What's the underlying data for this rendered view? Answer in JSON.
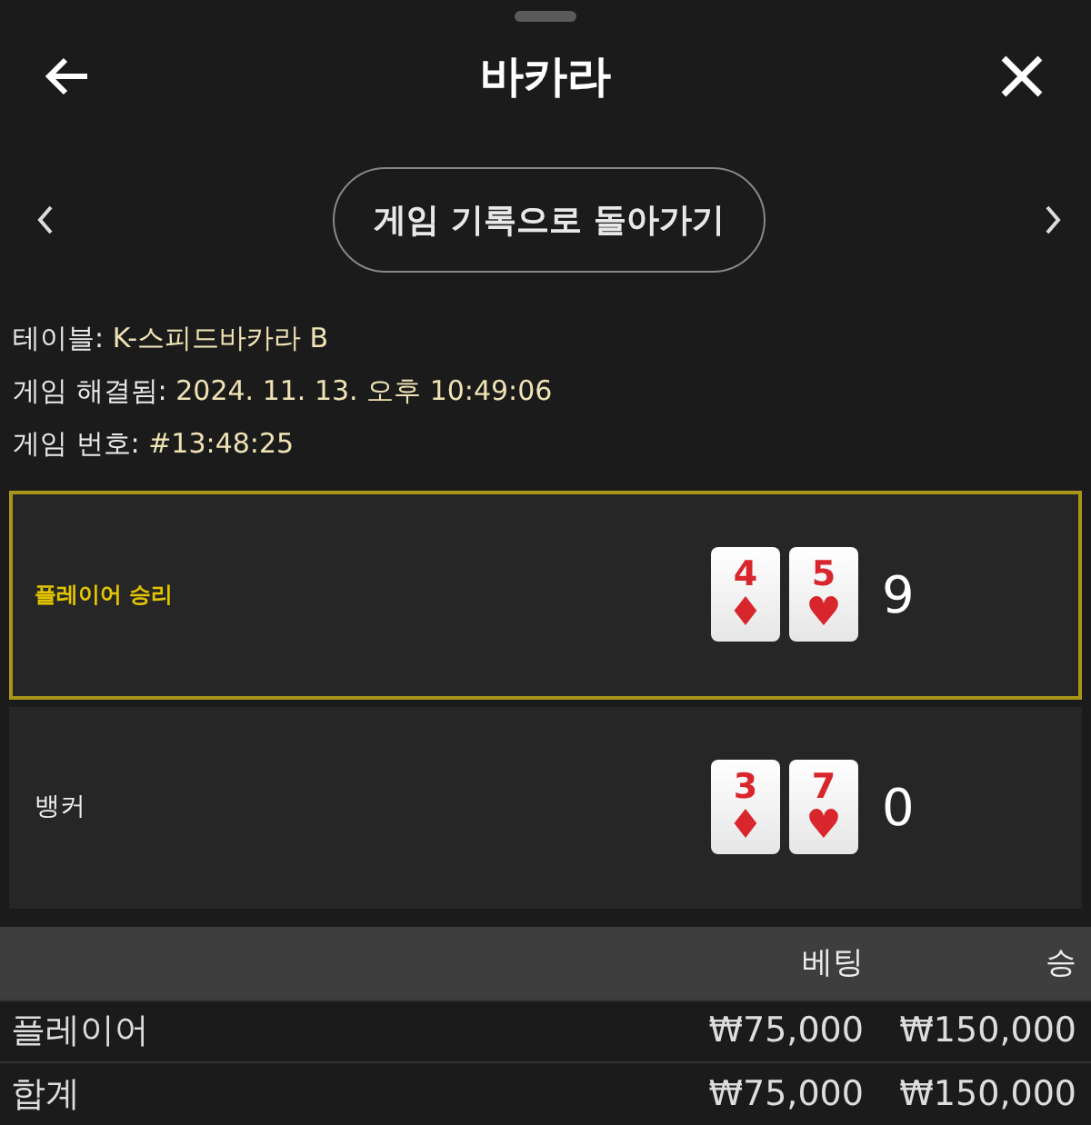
{
  "header": {
    "title": "바카라"
  },
  "nav": {
    "button": "게임 기록으로 돌아가기"
  },
  "info": [
    {
      "label": "테이블:",
      "value": "K-스피드바카라 B"
    },
    {
      "label": "게임 해결됨:",
      "value": "2024. 11. 13. 오후 10:49:06"
    },
    {
      "label": "게임 번호:",
      "value": "#13:48:25"
    }
  ],
  "hands": [
    {
      "name": "플레이어 승리",
      "winner": true,
      "score": "9",
      "cards": [
        {
          "rank": "4",
          "suit": "♦"
        },
        {
          "rank": "5",
          "suit": "♥"
        }
      ]
    },
    {
      "name": "뱅커",
      "winner": false,
      "score": "0",
      "cards": [
        {
          "rank": "3",
          "suit": "♦"
        },
        {
          "rank": "7",
          "suit": "♥"
        }
      ]
    }
  ],
  "table": {
    "columns": [
      "베팅",
      "승"
    ],
    "rows": [
      {
        "label": "플레이어",
        "bet": "₩75,000",
        "win": "₩150,000"
      },
      {
        "label": "합계",
        "bet": "₩75,000",
        "win": "₩150,000"
      }
    ]
  }
}
